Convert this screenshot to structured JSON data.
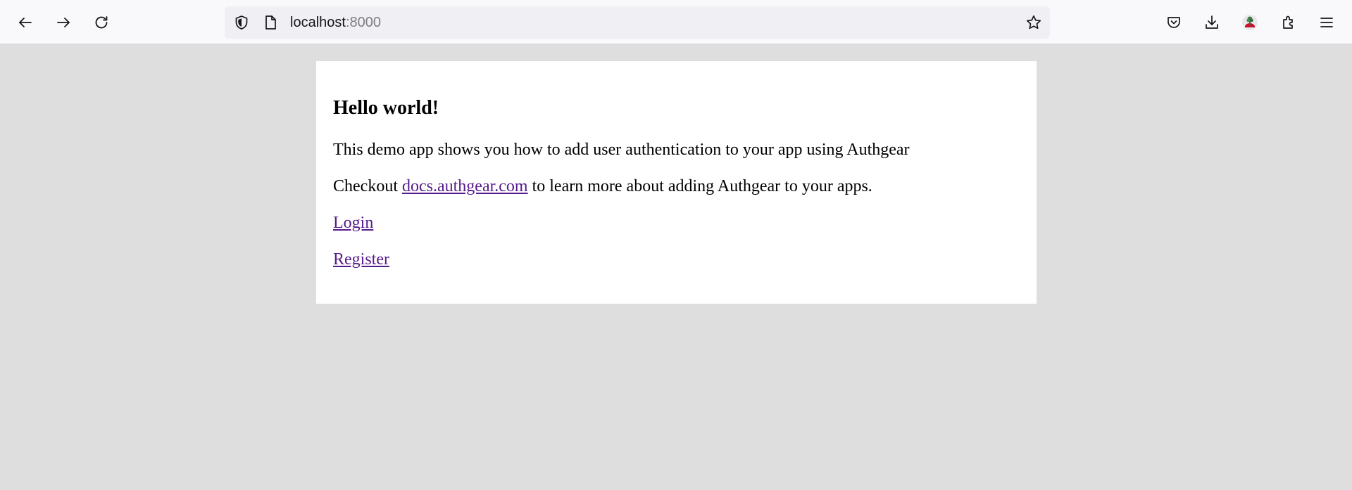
{
  "browser": {
    "url_host": "localhost",
    "url_port": ":8000",
    "icons": [
      "back-icon",
      "forward-icon",
      "reload-icon",
      "shield-icon",
      "page-icon",
      "star-icon",
      "pocket-icon",
      "download-icon",
      "account-icon",
      "extensions-icon",
      "menu-icon"
    ]
  },
  "page": {
    "heading": "Hello world!",
    "intro": "This demo app shows you how to add user authentication to your app using Authgear",
    "checkout_prefix": "Checkout ",
    "docs_link": "docs.authgear.com",
    "checkout_suffix": " to learn more about adding Authgear to your apps.",
    "login_link": "Login",
    "register_link": "Register"
  },
  "colors": {
    "toolbar_bg": "#f9f9fb",
    "urlbar_bg": "#f0f0f4",
    "page_bg": "#dedede",
    "card_bg": "#ffffff",
    "visited_link": "#551a8b"
  }
}
